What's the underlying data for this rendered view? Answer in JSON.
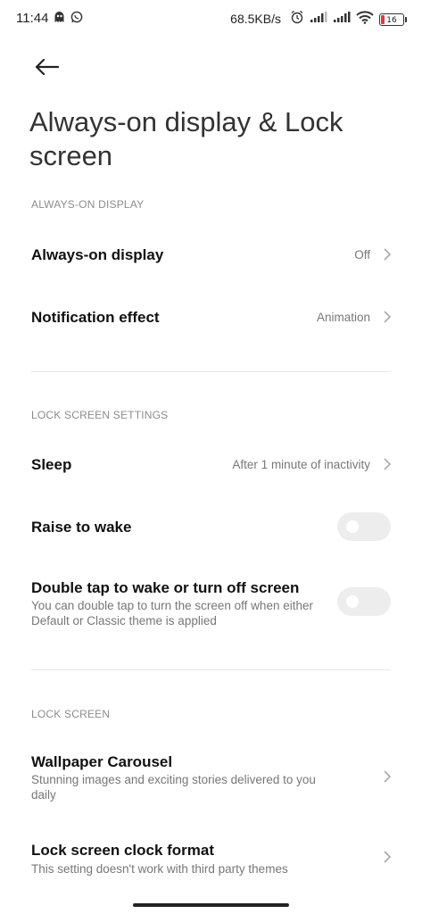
{
  "status_bar": {
    "time": "11:44",
    "speed": "68.5KB/s",
    "battery_level": "16",
    "icons_left": [
      "ghost-notification-icon",
      "whatsapp-icon"
    ],
    "icons_right": [
      "alarm-icon",
      "signal-icon",
      "signal-icon",
      "wifi-icon",
      "battery-icon"
    ]
  },
  "header": {
    "back_icon": "back-arrow-icon",
    "title": "Always-on display & Lock screen"
  },
  "sections": {
    "always_on": {
      "header": "ALWAYS-ON DISPLAY",
      "items": [
        {
          "title": "Always-on display",
          "value": "Off"
        },
        {
          "title": "Notification effect",
          "value": "Animation"
        }
      ]
    },
    "lock_settings": {
      "header": "LOCK SCREEN SETTINGS",
      "sleep": {
        "title": "Sleep",
        "value": "After 1 minute of inactivity"
      },
      "raise_to_wake": {
        "title": "Raise to wake",
        "enabled": false
      },
      "double_tap": {
        "title": "Double tap to wake or turn off screen",
        "subtitle": "You can double tap to turn the screen off when either Default or Classic theme is applied",
        "enabled": false
      }
    },
    "lock_screen": {
      "header": "LOCK SCREEN",
      "wallpaper_carousel": {
        "title": "Wallpaper Carousel",
        "subtitle": "Stunning images and exciting stories delivered to you daily"
      },
      "clock_format": {
        "title": "Lock screen clock format",
        "subtitle": "This setting doesn't work with third party themes"
      }
    }
  },
  "colors": {
    "section_header": "#8c8c8c",
    "toggle_off": "#ededed",
    "battery_low": "#e53935"
  }
}
